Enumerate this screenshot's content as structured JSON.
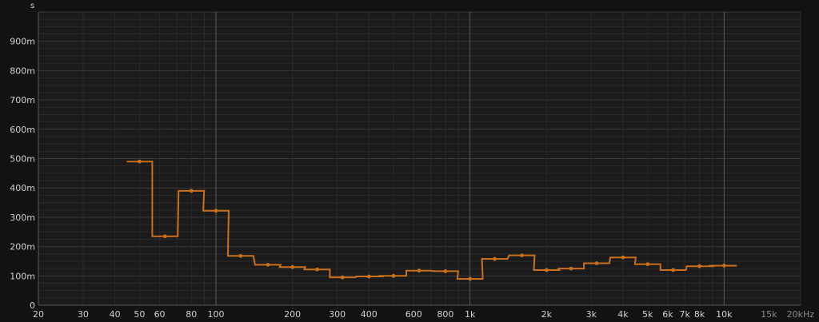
{
  "chart_data": {
    "type": "line",
    "style": "step",
    "xscale": "log",
    "ylabel": "s",
    "xlim": [
      20,
      20000
    ],
    "ylim": [
      0,
      1
    ],
    "grid": true,
    "colors": {
      "background": "#121212",
      "plot": "#1b1b1b",
      "grid_minor": "#2a2a2a",
      "grid_major": "#3a3a3a",
      "grid_decade": "#5a5a5a",
      "series": "#c9701c",
      "text": "#d0d0d0",
      "text_dim": "#8a8a8a"
    },
    "y_ticks": [
      {
        "value": 0,
        "label": "0"
      },
      {
        "value": 0.1,
        "label": "100m"
      },
      {
        "value": 0.2,
        "label": "200m"
      },
      {
        "value": 0.3,
        "label": "300m"
      },
      {
        "value": 0.4,
        "label": "400m"
      },
      {
        "value": 0.5,
        "label": "500m"
      },
      {
        "value": 0.6,
        "label": "600m"
      },
      {
        "value": 0.7,
        "label": "700m"
      },
      {
        "value": 0.8,
        "label": "800m"
      },
      {
        "value": 0.9,
        "label": "900m"
      }
    ],
    "x_ticks": [
      {
        "value": 20,
        "label": "20"
      },
      {
        "value": 30,
        "label": "30"
      },
      {
        "value": 40,
        "label": "40"
      },
      {
        "value": 50,
        "label": "50"
      },
      {
        "value": 60,
        "label": "60"
      },
      {
        "value": 80,
        "label": "80"
      },
      {
        "value": 100,
        "label": "100"
      },
      {
        "value": 200,
        "label": "200"
      },
      {
        "value": 300,
        "label": "300"
      },
      {
        "value": 400,
        "label": "400"
      },
      {
        "value": 600,
        "label": "600"
      },
      {
        "value": 800,
        "label": "800"
      },
      {
        "value": 1000,
        "label": "1k"
      },
      {
        "value": 2000,
        "label": "2k"
      },
      {
        "value": 3000,
        "label": "3k"
      },
      {
        "value": 4000,
        "label": "4k"
      },
      {
        "value": 5000,
        "label": "5k"
      },
      {
        "value": 6000,
        "label": "6k"
      },
      {
        "value": 7000,
        "label": "7k"
      },
      {
        "value": 8000,
        "label": "8k"
      },
      {
        "value": 10000,
        "label": "10k"
      },
      {
        "value": 15000,
        "label": "15k"
      },
      {
        "value": 20000,
        "label": "20kHz"
      }
    ],
    "series": [
      {
        "x": [
          50,
          63,
          80,
          100,
          125,
          160,
          200,
          250,
          315,
          400,
          500,
          630,
          800,
          1000,
          1250,
          1600,
          2000,
          2500,
          3150,
          4000,
          5000,
          6300,
          8000,
          10000
        ],
        "values": [
          0.49,
          0.235,
          0.39,
          0.322,
          0.168,
          0.138,
          0.13,
          0.122,
          0.095,
          0.098,
          0.1,
          0.118,
          0.116,
          0.09,
          0.158,
          0.17,
          0.12,
          0.125,
          0.143,
          0.163,
          0.14,
          0.12,
          0.133,
          0.135
        ]
      }
    ]
  }
}
